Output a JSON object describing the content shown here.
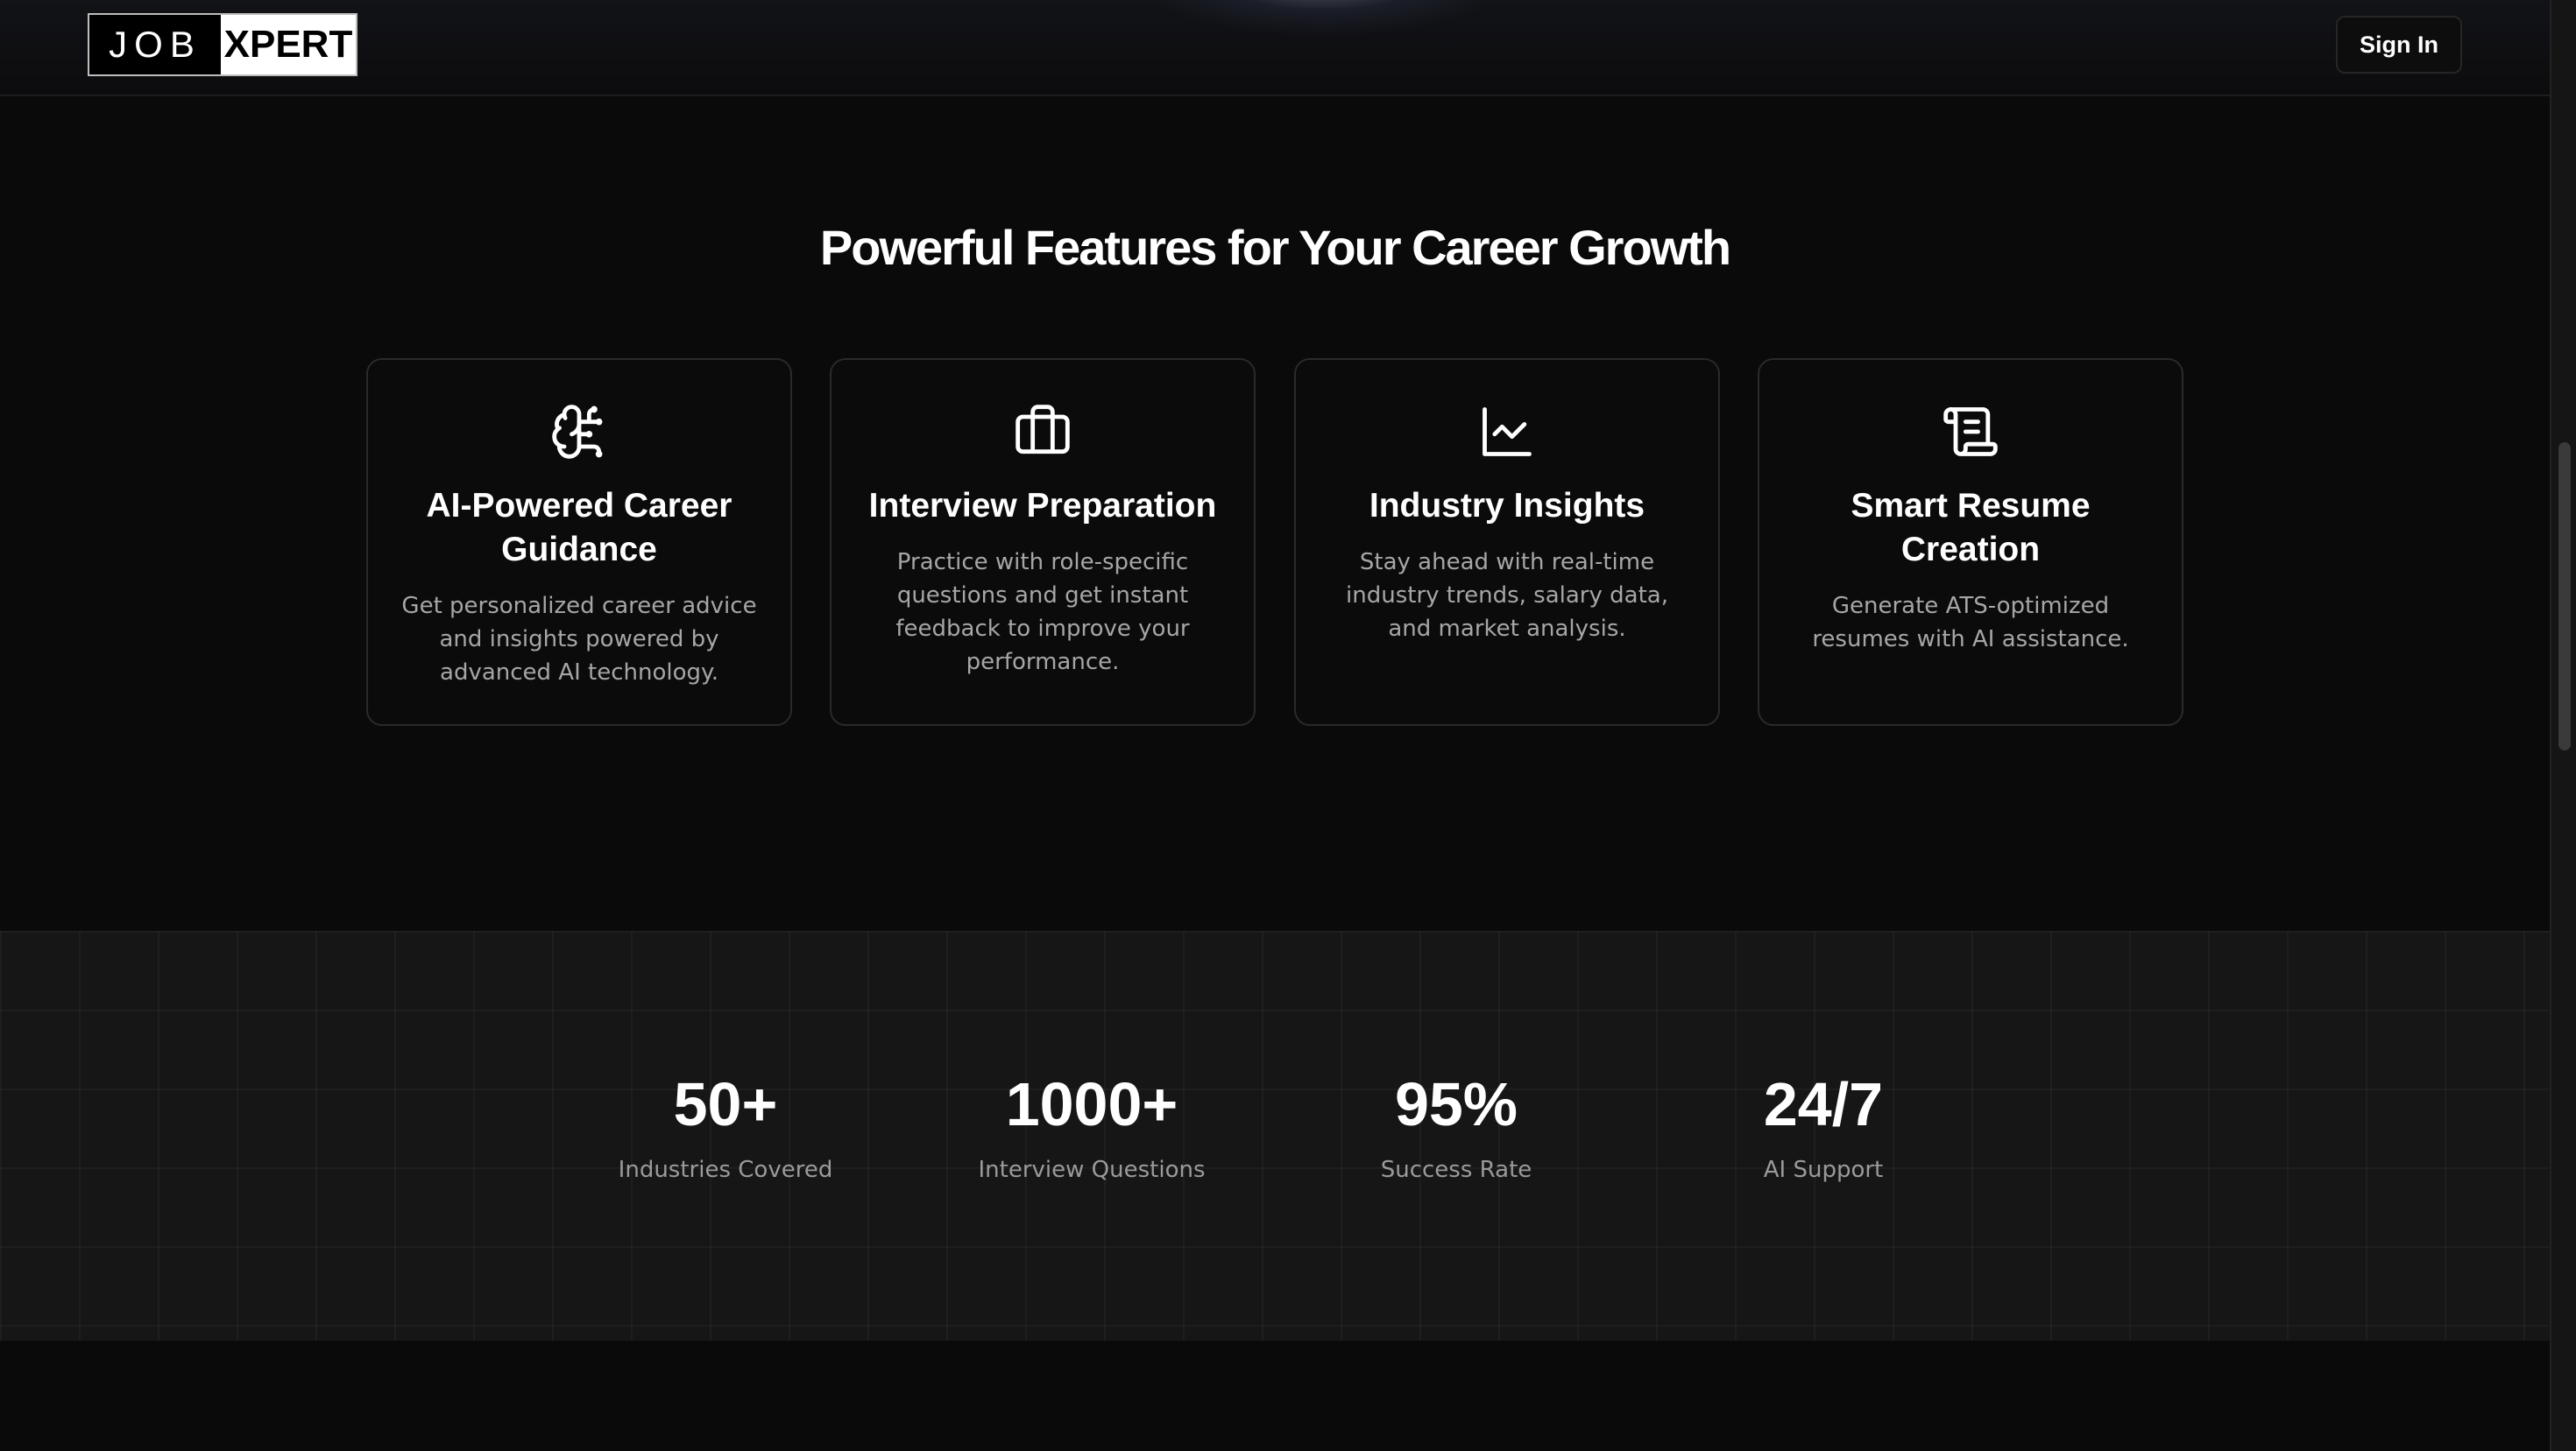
{
  "header": {
    "logo_left": "JOB",
    "logo_right": "XPERT",
    "signin_label": "Sign In"
  },
  "features": {
    "title": "Powerful Features for Your Career Growth",
    "cards": [
      {
        "icon": "brain-icon",
        "title": "AI-Powered Career Guidance",
        "description": "Get personalized career advice and insights powered by advanced AI technology."
      },
      {
        "icon": "briefcase-icon",
        "title": "Interview Preparation",
        "description": "Practice with role-specific questions and get instant feedback to improve your performance."
      },
      {
        "icon": "line-chart-icon",
        "title": "Industry Insights",
        "description": "Stay ahead with real-time industry trends, salary data, and market analysis."
      },
      {
        "icon": "scroll-text-icon",
        "title": "Smart Resume Creation",
        "description": "Generate ATS-optimized resumes with AI assistance."
      }
    ]
  },
  "stats": [
    {
      "value": "50+",
      "label": "Industries Covered"
    },
    {
      "value": "1000+",
      "label": "Interview Questions"
    },
    {
      "value": "95%",
      "label": "Success Rate"
    },
    {
      "value": "24/7",
      "label": "AI Support"
    }
  ]
}
